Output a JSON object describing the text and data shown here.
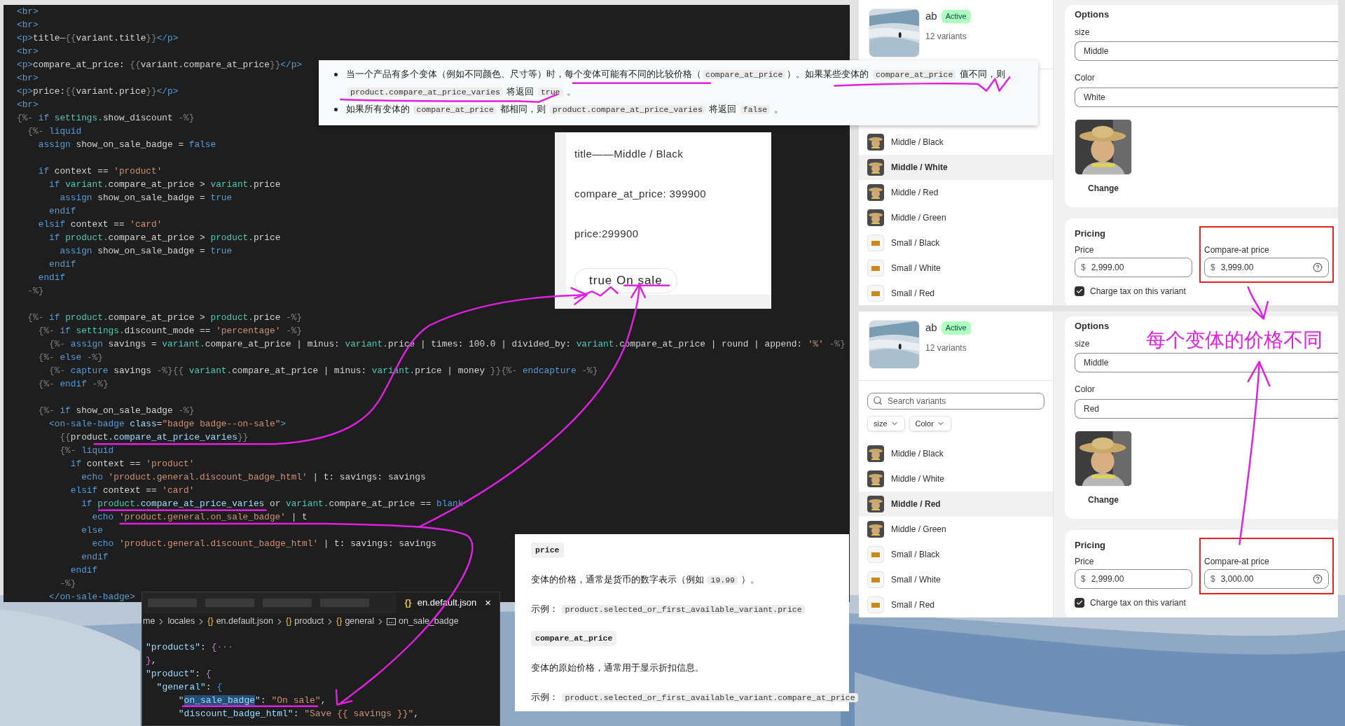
{
  "code_editor": {
    "lines": [
      {
        "kind": "code",
        "tokens": [
          {
            "kind": "tag",
            "text": "<br>"
          }
        ]
      },
      {
        "kind": "code",
        "tokens": [
          {
            "kind": "tag",
            "text": "<br>"
          }
        ]
      },
      {
        "kind": "code",
        "tokens": [
          {
            "kind": "tag",
            "text": "<p>"
          },
          {
            "kind": "text",
            "text": "title—"
          },
          {
            "kind": "punc",
            "text": "{{"
          },
          {
            "kind": "text",
            "text": "variant.title"
          },
          {
            "kind": "punc",
            "text": "}}"
          },
          {
            "kind": "tag",
            "text": "</p>"
          }
        ]
      },
      {
        "kind": "code",
        "tokens": [
          {
            "kind": "tag",
            "text": "<br>"
          }
        ]
      },
      {
        "kind": "code",
        "tokens": [
          {
            "kind": "tag",
            "text": "<p>"
          },
          {
            "kind": "text",
            "text": "compare_at_price: "
          },
          {
            "kind": "punc",
            "text": "{{"
          },
          {
            "kind": "text",
            "text": "variant.compare_at_price"
          },
          {
            "kind": "punc",
            "text": "}}"
          },
          {
            "kind": "tag",
            "text": "</p>"
          }
        ]
      },
      {
        "kind": "code",
        "tokens": [
          {
            "kind": "tag",
            "text": "<br>"
          }
        ]
      },
      {
        "kind": "code",
        "tokens": [
          {
            "kind": "tag",
            "text": "<p>"
          },
          {
            "kind": "text",
            "text": "price:"
          },
          {
            "kind": "punc",
            "text": "{{"
          },
          {
            "kind": "text",
            "text": "variant.price"
          },
          {
            "kind": "punc",
            "text": "}}"
          },
          {
            "kind": "tag",
            "text": "</p>"
          }
        ]
      },
      {
        "kind": "code",
        "tokens": [
          {
            "kind": "tag",
            "text": "<br>"
          }
        ]
      },
      {
        "kind": "code",
        "tokens": [
          {
            "kind": "punc",
            "text": "{%- "
          },
          {
            "kind": "kw",
            "text": "if "
          },
          {
            "kind": "obj",
            "text": "settings."
          },
          {
            "kind": "text",
            "text": "show_discount"
          },
          {
            "kind": "punc",
            "text": " -%}"
          }
        ]
      },
      {
        "kind": "code",
        "tokens": [
          {
            "kind": "punc",
            "text": "  {%- "
          },
          {
            "kind": "kw",
            "text": "liquid"
          }
        ]
      },
      {
        "kind": "code",
        "tokens": [
          {
            "kind": "kw",
            "text": "    assign "
          },
          {
            "kind": "text",
            "text": "show_on_sale_badge = "
          },
          {
            "kind": "val",
            "text": "false"
          }
        ]
      },
      {
        "kind": "blank"
      },
      {
        "kind": "code",
        "tokens": [
          {
            "kind": "kw",
            "text": "    if "
          },
          {
            "kind": "text",
            "text": "context == "
          },
          {
            "kind": "str",
            "text": "'product'"
          }
        ]
      },
      {
        "kind": "code",
        "tokens": [
          {
            "kind": "kw",
            "text": "      if "
          },
          {
            "kind": "obj",
            "text": "variant."
          },
          {
            "kind": "text",
            "text": "compare_at_price > "
          },
          {
            "kind": "obj",
            "text": "variant."
          },
          {
            "kind": "text",
            "text": "price"
          }
        ]
      },
      {
        "kind": "code",
        "tokens": [
          {
            "kind": "kw",
            "text": "        assign "
          },
          {
            "kind": "text",
            "text": "show_on_sale_badge = "
          },
          {
            "kind": "val",
            "text": "true"
          }
        ]
      },
      {
        "kind": "code",
        "tokens": [
          {
            "kind": "kw",
            "text": "      endif"
          }
        ]
      },
      {
        "kind": "code",
        "tokens": [
          {
            "kind": "kw",
            "text": "    elsif "
          },
          {
            "kind": "text",
            "text": "context == "
          },
          {
            "kind": "str",
            "text": "'card'"
          }
        ]
      },
      {
        "kind": "code",
        "tokens": [
          {
            "kind": "kw",
            "text": "      if "
          },
          {
            "kind": "obj",
            "text": "product."
          },
          {
            "kind": "text",
            "text": "compare_at_price > "
          },
          {
            "kind": "obj",
            "text": "product."
          },
          {
            "kind": "text",
            "text": "price"
          }
        ]
      },
      {
        "kind": "code",
        "tokens": [
          {
            "kind": "kw",
            "text": "        assign "
          },
          {
            "kind": "text",
            "text": "show_on_sale_badge = "
          },
          {
            "kind": "val",
            "text": "true"
          }
        ]
      },
      {
        "kind": "code",
        "tokens": [
          {
            "kind": "kw",
            "text": "      endif"
          }
        ]
      },
      {
        "kind": "code",
        "tokens": [
          {
            "kind": "kw",
            "text": "    endif"
          }
        ]
      },
      {
        "kind": "code",
        "tokens": [
          {
            "kind": "punc",
            "text": "  -%}"
          }
        ]
      },
      {
        "kind": "blank"
      },
      {
        "kind": "code",
        "tokens": [
          {
            "kind": "punc",
            "text": "  {%- "
          },
          {
            "kind": "kw",
            "text": "if "
          },
          {
            "kind": "obj",
            "text": "product."
          },
          {
            "kind": "text",
            "text": "compare_at_price > "
          },
          {
            "kind": "obj",
            "text": "product."
          },
          {
            "kind": "text",
            "text": "price"
          },
          {
            "kind": "punc",
            "text": " -%}"
          }
        ]
      },
      {
        "kind": "code",
        "tokens": [
          {
            "kind": "punc",
            "text": "    {%- "
          },
          {
            "kind": "kw",
            "text": "if "
          },
          {
            "kind": "obj",
            "text": "settings."
          },
          {
            "kind": "text",
            "text": "discount_mode == "
          },
          {
            "kind": "str",
            "text": "'percentage'"
          },
          {
            "kind": "punc",
            "text": " -%}"
          }
        ]
      },
      {
        "kind": "code",
        "tokens": [
          {
            "kind": "punc",
            "text": "      {%- "
          },
          {
            "kind": "kw",
            "text": "assign "
          },
          {
            "kind": "text",
            "text": "savings = "
          },
          {
            "kind": "obj",
            "text": "variant."
          },
          {
            "kind": "text",
            "text": "compare_at_price | minus: "
          },
          {
            "kind": "obj",
            "text": "variant."
          },
          {
            "kind": "text",
            "text": "price | times: 100.0 | divided_by: "
          },
          {
            "kind": "obj",
            "text": "variant."
          },
          {
            "kind": "text",
            "text": "compare_at_price | round | append: "
          },
          {
            "kind": "str",
            "text": "'%'"
          },
          {
            "kind": "punc",
            "text": " -%}"
          }
        ]
      },
      {
        "kind": "code",
        "tokens": [
          {
            "kind": "punc",
            "text": "    {%- "
          },
          {
            "kind": "kw",
            "text": "else"
          },
          {
            "kind": "punc",
            "text": " -%}"
          }
        ]
      },
      {
        "kind": "code",
        "tokens": [
          {
            "kind": "punc",
            "text": "      {%- "
          },
          {
            "kind": "kw",
            "text": "capture "
          },
          {
            "kind": "text",
            "text": "savings "
          },
          {
            "kind": "punc",
            "text": "-%}{{ "
          },
          {
            "kind": "obj",
            "text": "variant."
          },
          {
            "kind": "text",
            "text": "compare_at_price | minus: "
          },
          {
            "kind": "obj",
            "text": "variant."
          },
          {
            "kind": "text",
            "text": "price | money "
          },
          {
            "kind": "punc",
            "text": "}}{%- "
          },
          {
            "kind": "kw",
            "text": "endcapture"
          },
          {
            "kind": "punc",
            "text": " -%}"
          }
        ]
      },
      {
        "kind": "code",
        "tokens": [
          {
            "kind": "punc",
            "text": "    {%- "
          },
          {
            "kind": "kw",
            "text": "endif"
          },
          {
            "kind": "punc",
            "text": " -%}"
          }
        ]
      },
      {
        "kind": "blank"
      },
      {
        "kind": "code",
        "tokens": [
          {
            "kind": "punc",
            "text": "    {%- "
          },
          {
            "kind": "kw",
            "text": "if "
          },
          {
            "kind": "text",
            "text": "show_on_sale_badge"
          },
          {
            "kind": "punc",
            "text": " -%}"
          }
        ]
      },
      {
        "kind": "code",
        "tokens": [
          {
            "kind": "tag",
            "text": "      <on-sale-badge "
          },
          {
            "kind": "prop",
            "text": "class"
          },
          {
            "kind": "text",
            "text": "="
          },
          {
            "kind": "str",
            "text": "\"badge badge--on-sale\""
          },
          {
            "kind": "tag",
            "text": ">"
          }
        ]
      },
      {
        "kind": "code",
        "tokens": [
          {
            "kind": "punc",
            "text": "        {{"
          },
          {
            "kind": "text",
            "text": "product"
          },
          {
            "kind": "prop",
            "text": ".compare_at_price_varies"
          },
          {
            "kind": "punc",
            "text": "}}"
          }
        ]
      },
      {
        "kind": "code",
        "tokens": [
          {
            "kind": "punc",
            "text": "        {%- "
          },
          {
            "kind": "kw",
            "text": "liquid"
          }
        ]
      },
      {
        "kind": "code",
        "tokens": [
          {
            "kind": "kw",
            "text": "          if "
          },
          {
            "kind": "text",
            "text": "context == "
          },
          {
            "kind": "str",
            "text": "'product'"
          }
        ]
      },
      {
        "kind": "code",
        "tokens": [
          {
            "kind": "kw",
            "text": "            echo "
          },
          {
            "kind": "str",
            "text": "'product.general.discount_badge_html'"
          },
          {
            "kind": "text",
            "text": " | t: savings: savings"
          }
        ]
      },
      {
        "kind": "code",
        "tokens": [
          {
            "kind": "kw",
            "text": "          elsif "
          },
          {
            "kind": "text",
            "text": "context == "
          },
          {
            "kind": "str",
            "text": "'card'"
          }
        ]
      },
      {
        "kind": "code",
        "tokens": [
          {
            "kind": "kw",
            "text": "            if "
          },
          {
            "kind": "obj",
            "text": "product."
          },
          {
            "kind": "prop",
            "text": "compare_at_price_varies"
          },
          {
            "kind": "text",
            "text": " or "
          },
          {
            "kind": "obj",
            "text": "variant."
          },
          {
            "kind": "text",
            "text": "compare_at_price == "
          },
          {
            "kind": "val",
            "text": "blank"
          }
        ]
      },
      {
        "kind": "code",
        "tokens": [
          {
            "kind": "kw",
            "text": "              echo "
          },
          {
            "kind": "str",
            "text": "'product.general.on_sale_badge'"
          },
          {
            "kind": "text",
            "text": " | t"
          }
        ]
      },
      {
        "kind": "code",
        "tokens": [
          {
            "kind": "kw",
            "text": "            else"
          }
        ]
      },
      {
        "kind": "code",
        "tokens": [
          {
            "kind": "kw",
            "text": "              echo "
          },
          {
            "kind": "str",
            "text": "'product.general.discount_badge_html'"
          },
          {
            "kind": "text",
            "text": " | t: savings: savings"
          }
        ]
      },
      {
        "kind": "code",
        "tokens": [
          {
            "kind": "kw",
            "text": "            endif"
          }
        ]
      },
      {
        "kind": "code",
        "tokens": [
          {
            "kind": "kw",
            "text": "          endif"
          }
        ]
      },
      {
        "kind": "code",
        "tokens": [
          {
            "kind": "punc",
            "text": "        -%}"
          }
        ]
      },
      {
        "kind": "code",
        "tokens": [
          {
            "kind": "tag",
            "text": "      </on-sale-badge>"
          }
        ]
      }
    ]
  },
  "doc_tooltip": {
    "bullets": [
      [
        {
          "kind": "text",
          "text": "当一个产品有多个变体（例如不同颜色、尺寸等）时，每个变体可能有不同的比较价格（"
        },
        {
          "kind": "code",
          "text": "compare_at_price"
        },
        {
          "kind": "text",
          "text": "）。如果某些变体的 "
        },
        {
          "kind": "code",
          "text": "compare_at_price"
        },
        {
          "kind": "text",
          "text": " 值不同，则 "
        },
        {
          "kind": "code",
          "text": "product.compare_at_price_varies"
        },
        {
          "kind": "text",
          "text": " 将返回 "
        },
        {
          "kind": "code",
          "text": "true"
        },
        {
          "kind": "text",
          "text": " 。"
        }
      ],
      [
        {
          "kind": "text",
          "text": "如果所有变体的 "
        },
        {
          "kind": "code",
          "text": "compare_at_price"
        },
        {
          "kind": "text",
          "text": " 都相同，则 "
        },
        {
          "kind": "code",
          "text": "product.compare_at_price_varies"
        },
        {
          "kind": "text",
          "text": " 将返回 "
        },
        {
          "kind": "code",
          "text": "false"
        },
        {
          "kind": "text",
          "text": " 。"
        }
      ]
    ]
  },
  "preview": {
    "lines": [
      "title——Middle / Black",
      "compare_at_price: 399900",
      "price:299900"
    ],
    "badge": "true On sale"
  },
  "json_editor": {
    "tabs": [
      {
        "kind": "obscured",
        "selected": false
      },
      {
        "kind": "obscured",
        "selected": false
      },
      {
        "kind": "obscured",
        "selected": false
      },
      {
        "kind": "obscured",
        "selected": false
      },
      {
        "kind": "file",
        "glyph": "{}",
        "label": "en.default.json",
        "close": "×",
        "selected": true
      }
    ],
    "breadcrumb": [
      {
        "kind": "folder",
        "label": "me"
      },
      {
        "kind": "folder",
        "label": "locales"
      },
      {
        "kind": "object",
        "glyph": "{}",
        "label": "en.default.json"
      },
      {
        "kind": "object",
        "glyph": "{}",
        "label": "product"
      },
      {
        "kind": "object",
        "glyph": "{}",
        "label": "general"
      },
      {
        "kind": "string",
        "label": "on_sale_badge"
      }
    ],
    "lines": [
      {
        "kind": "code",
        "tokens": [
          {
            "kind": "key",
            "text": "\"products\""
          },
          {
            "kind": "text",
            "text": ": "
          },
          {
            "kind": "brace_pink",
            "text": "{"
          },
          {
            "kind": "fold",
            "text": "···"
          }
        ]
      },
      {
        "kind": "code",
        "tokens": [
          {
            "kind": "brace_pink",
            "text": "}"
          },
          {
            "kind": "text",
            "text": ","
          }
        ]
      },
      {
        "kind": "code",
        "tokens": [
          {
            "kind": "key",
            "text": "\"product\""
          },
          {
            "kind": "text",
            "text": ": "
          },
          {
            "kind": "brace_pink",
            "text": "{"
          }
        ]
      },
      {
        "kind": "code",
        "tokens": [
          {
            "kind": "key",
            "text": "  \"general\""
          },
          {
            "kind": "text",
            "text": ": "
          },
          {
            "kind": "brace_blue",
            "text": "{"
          }
        ]
      },
      {
        "kind": "code",
        "tokens": [
          {
            "kind": "key",
            "text": "      \""
          },
          {
            "kind": "sel",
            "text": "on_sale_badge"
          },
          {
            "kind": "key",
            "text": "\""
          },
          {
            "kind": "text",
            "text": ": "
          },
          {
            "kind": "str",
            "text": "\"On sale\""
          },
          {
            "kind": "text",
            "text": ","
          }
        ]
      },
      {
        "kind": "code",
        "tokens": [
          {
            "kind": "key",
            "text": "      \"discount_badge_html\""
          },
          {
            "kind": "text",
            "text": ": "
          },
          {
            "kind": "str",
            "text": "\"Save {{ savings }}\""
          },
          {
            "kind": "text",
            "text": ","
          }
        ]
      }
    ]
  },
  "doc_panel": {
    "entries": [
      {
        "term": "price",
        "description": [
          {
            "kind": "text",
            "text": "变体的价格，通常是货币的数字表示（例如 "
          },
          {
            "kind": "code",
            "text": "19.99"
          },
          {
            "kind": "text",
            "text": " ）。"
          }
        ],
        "example": [
          {
            "kind": "text",
            "text": "示例： "
          },
          {
            "kind": "code",
            "text": "product.selected_or_first_available_variant.price"
          }
        ]
      },
      {
        "term": "compare_at_price",
        "description": [
          {
            "kind": "text",
            "text": "变体的原始价格，通常用于显示折扣信息。"
          }
        ],
        "example": [
          {
            "kind": "text",
            "text": "示例： "
          },
          {
            "kind": "code",
            "text": "product.selected_or_first_available_variant.compare_at_price"
          }
        ]
      }
    ]
  },
  "product_panels": [
    {
      "title": "ab",
      "status": "Active",
      "variant_count": "12 variants",
      "variants": [
        {
          "label": "Middle / Black",
          "selected": false
        },
        {
          "label": "Middle / White",
          "selected": true
        },
        {
          "label": "Middle / Red",
          "selected": false
        },
        {
          "label": "Middle / Green",
          "selected": false
        },
        {
          "label": "Small / Black",
          "kind": "swatch",
          "selected": false
        },
        {
          "label": "Small / White",
          "kind": "swatch",
          "selected": false
        },
        {
          "label": "Small / Red",
          "kind": "swatch",
          "selected": false
        }
      ],
      "options": {
        "heading": "Options",
        "fields": [
          {
            "label": "size",
            "value": "Middle"
          },
          {
            "label": "Color",
            "value": "White"
          }
        ],
        "image_action": "Change"
      },
      "pricing": {
        "heading": "Pricing",
        "price": {
          "label": "Price",
          "currency": "$",
          "value": "2,999.00"
        },
        "compare_at": {
          "label": "Compare-at price",
          "currency": "$",
          "value": "3,999.00",
          "highlighted": true
        },
        "tax": {
          "label": "Charge tax on this variant",
          "checked": true
        }
      }
    },
    {
      "title": "ab",
      "status": "Active",
      "variant_count": "12 variants",
      "search": {
        "placeholder": "Search variants"
      },
      "filters": [
        {
          "label": "size"
        },
        {
          "label": "Color"
        }
      ],
      "variants": [
        {
          "label": "Middle / Black",
          "selected": false
        },
        {
          "label": "Middle / White",
          "selected": false
        },
        {
          "label": "Middle / Red",
          "selected": true
        },
        {
          "label": "Middle / Green",
          "selected": false
        },
        {
          "label": "Small / Black",
          "kind": "swatch",
          "selected": false
        },
        {
          "label": "Small / White",
          "kind": "swatch",
          "selected": false
        },
        {
          "label": "Small / Red",
          "kind": "swatch",
          "selected": false
        }
      ],
      "options": {
        "heading": "Options",
        "fields": [
          {
            "label": "size",
            "value": "Middle"
          },
          {
            "label": "Color",
            "value": "Red"
          }
        ],
        "image_action": "Change"
      },
      "pricing": {
        "heading": "Pricing",
        "price": {
          "label": "Price",
          "currency": "$",
          "value": "2,999.00"
        },
        "compare_at": {
          "label": "Compare-at price",
          "currency": "$",
          "value": "3,000.00",
          "highlighted": true
        },
        "tax": {
          "label": "Charge tax on this variant",
          "checked": true
        }
      }
    }
  ],
  "annotation": {
    "text": "每个变体的价格不同"
  }
}
